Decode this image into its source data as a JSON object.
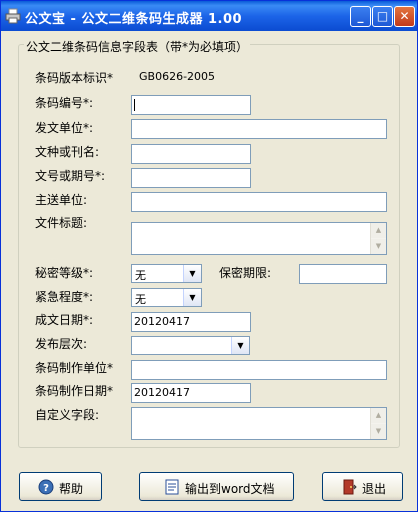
{
  "window": {
    "title": "公文宝 - 公文二维条码生成器 1.00",
    "controls": {
      "minimize": "_",
      "maximize": "□",
      "close": "✕"
    },
    "app_icon": "printer-icon"
  },
  "group": {
    "legend": "公文二维条码信息字段表（带*为必填项）"
  },
  "fields": {
    "version": {
      "label": "条码版本标识*",
      "value": "GB0626-2005"
    },
    "barcode_no": {
      "label": "条码编号*:",
      "value": ""
    },
    "issuer": {
      "label": "发文单位*:",
      "value": ""
    },
    "doc_type": {
      "label": "文种或刊名:",
      "value": ""
    },
    "doc_no": {
      "label": "文号或期号*:",
      "value": ""
    },
    "recipient": {
      "label": "主送单位:",
      "value": ""
    },
    "doc_title": {
      "label": "文件标题:",
      "value": ""
    },
    "secret_level": {
      "label": "秘密等级*:",
      "value": "无"
    },
    "secret_period": {
      "label": "保密期限:",
      "value": ""
    },
    "urgency": {
      "label": "紧急程度*:",
      "value": "无"
    },
    "date": {
      "label": "成文日期*:",
      "value": "20120417"
    },
    "level": {
      "label": "发布层次:",
      "value": ""
    },
    "maker": {
      "label": "条码制作单位*",
      "value": ""
    },
    "make_date": {
      "label": "条码制作日期*",
      "value": "20120417"
    },
    "custom": {
      "label": "自定义字段:",
      "value": ""
    }
  },
  "buttons": {
    "help": {
      "label": "帮助",
      "icon": "help-icon"
    },
    "export": {
      "label": "输出到word文档",
      "icon": "word-document-icon"
    },
    "exit": {
      "label": "退出",
      "icon": "exit-door-icon"
    }
  },
  "colors": {
    "titlebar": "#0b4bd1",
    "window_bg": "#ece9d8",
    "input_border": "#7f9db9"
  }
}
